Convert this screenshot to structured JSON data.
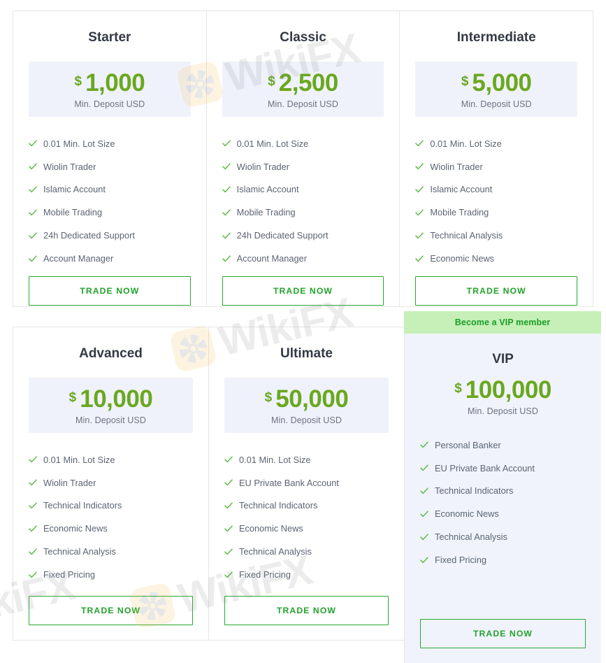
{
  "common": {
    "currency_symbol": "$",
    "price_subtitle": "Min. Deposit USD",
    "cta_label": "TRADE NOW",
    "check_icon": "check-icon",
    "watermark_text": "WikiFX",
    "accent_green": "#6aa81f",
    "cta_green": "#22a32c",
    "banner_green": "#c6f0b7",
    "price_box_blue": "#f0f2fb",
    "vip_body_blue": "#f0f3fc"
  },
  "plans": [
    {
      "id": "starter",
      "name": "Starter",
      "amount": "1,000",
      "features": [
        "0.01 Min. Lot Size",
        "Wiolin Trader",
        "Islamic Account",
        "Mobile Trading",
        "24h Dedicated Support",
        "Account Manager"
      ]
    },
    {
      "id": "classic",
      "name": "Classic",
      "amount": "2,500",
      "features": [
        "0.01 Min. Lot Size",
        "Wiolin Trader",
        "Islamic Account",
        "Mobile Trading",
        "24h Dedicated Support",
        "Account Manager"
      ]
    },
    {
      "id": "intermediate",
      "name": "Intermediate",
      "amount": "5,000",
      "features": [
        "0.01 Min. Lot Size",
        "Wiolin Trader",
        "Islamic Account",
        "Mobile Trading",
        "Technical Analysis",
        "Economic News"
      ]
    },
    {
      "id": "advanced",
      "name": "Advanced",
      "amount": "10,000",
      "features": [
        "0.01 Min. Lot Size",
        "Wiolin Trader",
        "Technical Indicators",
        "Economic News",
        "Technical Analysis",
        "Fixed Pricing"
      ]
    },
    {
      "id": "ultimate",
      "name": "Ultimate",
      "amount": "50,000",
      "features": [
        "0.01 Min. Lot Size",
        "EU Private Bank Account",
        "Technical Indicators",
        "Economic News",
        "Technical Analysis",
        "Fixed Pricing"
      ]
    },
    {
      "id": "vip",
      "name": "VIP",
      "amount": "100,000",
      "banner_label": "Become a VIP member",
      "features": [
        "Personal Banker",
        "EU Private Bank Account",
        "Technical Indicators",
        "Economic News",
        "Technical Analysis",
        "Fixed Pricing"
      ]
    }
  ]
}
